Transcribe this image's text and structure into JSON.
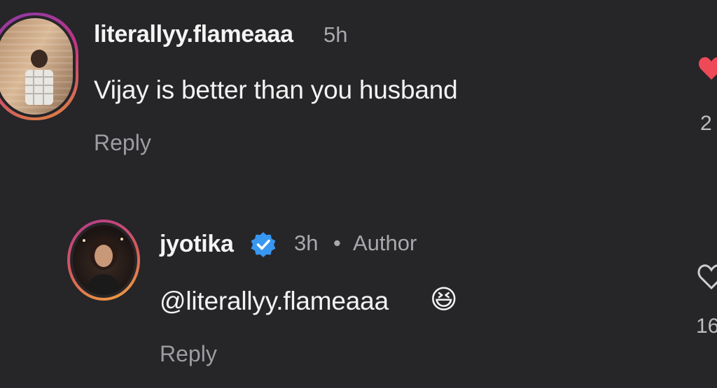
{
  "comments": [
    {
      "username": "literallyy.flameaaa",
      "time": "5h",
      "text": "Vijay is better than you husband",
      "reply_label": "Reply",
      "like_count": "2",
      "liked": true
    },
    {
      "username": "jyotika",
      "verified": true,
      "time": "3h",
      "separator": "•",
      "author_badge": "Author",
      "mention": "@literallyy.flameaaa",
      "emoji": "😆",
      "reply_label": "Reply",
      "like_count": "16",
      "liked": false
    }
  ],
  "colors": {
    "background": "#262528",
    "like_red": "#ed4956",
    "verified_blue": "#3897f0"
  },
  "icons": {
    "like_filled": "heart-filled-icon",
    "like_outline": "heart-outline-icon",
    "verified": "verified-badge-icon"
  }
}
